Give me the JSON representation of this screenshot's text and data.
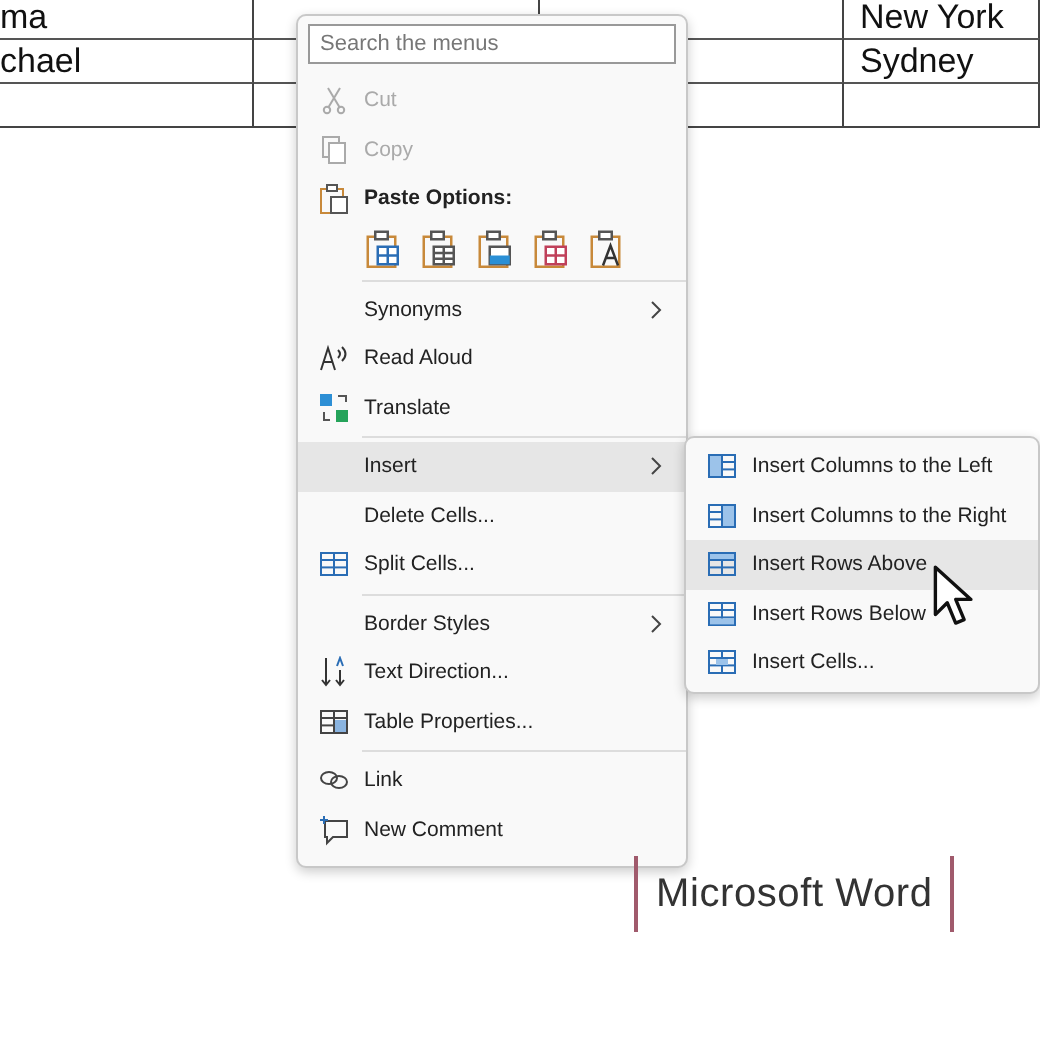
{
  "table": {
    "rows": [
      {
        "cells": [
          "ma",
          "",
          "",
          "New York"
        ]
      },
      {
        "cells": [
          "chael",
          "",
          "",
          "Sydney"
        ]
      },
      {
        "cells": [
          "",
          "",
          "",
          ""
        ]
      }
    ]
  },
  "context_menu": {
    "search": {
      "placeholder": "Search the menus"
    },
    "items": [
      {
        "kind": "item",
        "label": "Cut",
        "disabled": true,
        "submenu": false,
        "selected": false
      },
      {
        "kind": "item",
        "label": "Copy",
        "disabled": true,
        "submenu": false,
        "selected": false
      },
      {
        "kind": "header",
        "label": "Paste Options:"
      },
      {
        "kind": "paste_icons"
      },
      {
        "kind": "separator"
      },
      {
        "kind": "item",
        "label": "Synonyms",
        "disabled": false,
        "submenu": true,
        "selected": false
      },
      {
        "kind": "item",
        "label": "Read Aloud",
        "disabled": false,
        "submenu": false,
        "selected": false
      },
      {
        "kind": "item",
        "label": "Translate",
        "disabled": false,
        "submenu": false,
        "selected": false
      },
      {
        "kind": "separator"
      },
      {
        "kind": "item",
        "label": "Insert",
        "disabled": false,
        "submenu": true,
        "selected": true
      },
      {
        "kind": "item",
        "label": "Delete Cells...",
        "disabled": false,
        "submenu": false,
        "selected": false
      },
      {
        "kind": "item",
        "label": "Split Cells...",
        "disabled": false,
        "submenu": false,
        "selected": false
      },
      {
        "kind": "separator"
      },
      {
        "kind": "item",
        "label": "Border Styles",
        "disabled": false,
        "submenu": true,
        "selected": false
      },
      {
        "kind": "item",
        "label": "Text Direction...",
        "disabled": false,
        "submenu": false,
        "selected": false
      },
      {
        "kind": "item",
        "label": "Table Properties...",
        "disabled": false,
        "submenu": false,
        "selected": false
      },
      {
        "kind": "separator"
      },
      {
        "kind": "item",
        "label": "Link",
        "disabled": false,
        "submenu": false,
        "selected": false
      },
      {
        "kind": "item",
        "label": "New Comment",
        "disabled": false,
        "submenu": false,
        "selected": false
      }
    ]
  },
  "submenu": {
    "items": [
      {
        "label": "Insert Columns to the Left",
        "selected": false
      },
      {
        "label": "Insert Columns to the Right",
        "selected": false
      },
      {
        "label": "Insert Rows Above",
        "selected": true
      },
      {
        "label": "Insert Rows Below",
        "selected": false
      },
      {
        "label": "Insert Cells...",
        "selected": false
      }
    ]
  },
  "caption": "Microsoft Word"
}
